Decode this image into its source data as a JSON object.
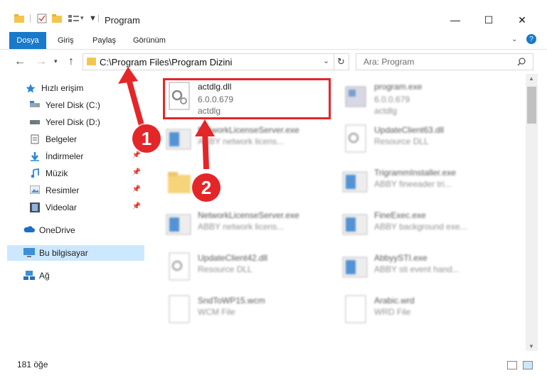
{
  "window": {
    "title": "Program",
    "minimize": "—",
    "maximize": "☐",
    "close": "✕"
  },
  "ribbon": {
    "tabs": [
      "Dosya",
      "Giriş",
      "Paylaş",
      "Görünüm"
    ]
  },
  "nav": {
    "address": "C:\\Program Files\\Program Dizini",
    "search_placeholder": "Ara: Program"
  },
  "sidebar": {
    "items": [
      {
        "label": "Hızlı erişim",
        "icon": "star-icon"
      },
      {
        "label": "Yerel Disk (C:)",
        "icon": "drive-icon"
      },
      {
        "label": "Yerel Disk (D:)",
        "icon": "drive-icon"
      },
      {
        "label": "Belgeler",
        "icon": "documents-icon"
      },
      {
        "label": "İndirmeler",
        "icon": "download-icon"
      },
      {
        "label": "Müzik",
        "icon": "music-icon"
      },
      {
        "label": "Resimler",
        "icon": "pictures-icon"
      },
      {
        "label": "Videolar",
        "icon": "video-icon"
      },
      {
        "label": "OneDrive",
        "icon": "cloud-icon"
      },
      {
        "label": "Bu bilgisayar",
        "icon": "computer-icon"
      },
      {
        "label": "Ağ",
        "icon": "network-icon"
      }
    ]
  },
  "files": [
    {
      "name": "actdlg.dll",
      "version": "6.0.0.679",
      "desc": "actdlg",
      "type": "dll",
      "highlighted": true
    },
    {
      "name": "program.exe",
      "version": "6.0.0.679",
      "desc": "actdlg",
      "type": "exe"
    },
    {
      "name": "NetworkLicenseServer.exe",
      "version": "",
      "desc": "ABBY network licens...",
      "type": "exe"
    },
    {
      "name": "UpdateClient63.dll",
      "version": "",
      "desc": "Resource DLL",
      "type": "dll"
    },
    {
      "name": "",
      "version": "",
      "desc": "",
      "type": "folder"
    },
    {
      "name": "TrigrammInstaller.exe",
      "version": "",
      "desc": "ABBY fineeader tri...",
      "type": "exe"
    },
    {
      "name": "NetworkLicenseServer.exe",
      "version": "",
      "desc": "ABBY network licens...",
      "type": "exe"
    },
    {
      "name": "FineExec.exe",
      "version": "",
      "desc": "ABBY background exe...",
      "type": "exe"
    },
    {
      "name": "UpdateClient42.dll",
      "version": "",
      "desc": "Resource DLL",
      "type": "dll"
    },
    {
      "name": "AbbyySTI.exe",
      "version": "",
      "desc": "ABBY sti event hand...",
      "type": "exe"
    },
    {
      "name": "SndToWP15.wcm",
      "version": "",
      "desc": "WCM File",
      "type": "doc"
    },
    {
      "name": "Arabic.wrd",
      "version": "",
      "desc": "WRD File",
      "type": "doc"
    }
  ],
  "status": {
    "count": "181 öğe"
  },
  "annotations": {
    "step1": "1",
    "step2": "2",
    "color": "#e42629"
  }
}
